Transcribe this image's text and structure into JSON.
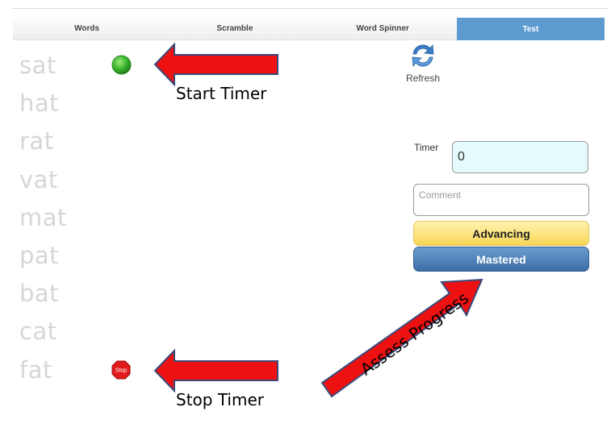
{
  "tabs": [
    {
      "label": "Words",
      "active": false
    },
    {
      "label": "Scramble",
      "active": false
    },
    {
      "label": "Word Spinner",
      "active": false
    },
    {
      "label": "Test",
      "active": true
    }
  ],
  "words": [
    "sat",
    "hat",
    "rat",
    "vat",
    "mat",
    "pat",
    "bat",
    "cat",
    "fat"
  ],
  "start_icon": {
    "name": "green-circle-icon",
    "color": "#2aa82a"
  },
  "stop_icon": {
    "name": "stop-sign-icon",
    "label": "Stop",
    "color": "#e02020"
  },
  "refresh": {
    "label": "Refresh",
    "icon": "refresh-icon",
    "color": "#3a7cc7"
  },
  "timer": {
    "label": "Timer",
    "value": "0"
  },
  "comment": {
    "placeholder": "Comment",
    "value": ""
  },
  "buttons": {
    "advancing": "Advancing",
    "mastered": "Mastered"
  },
  "annotations": {
    "start_timer": "Start Timer",
    "stop_timer": "Stop Timer",
    "assess_progress": "Assess Progress",
    "arrow_color": "#ee1111"
  }
}
